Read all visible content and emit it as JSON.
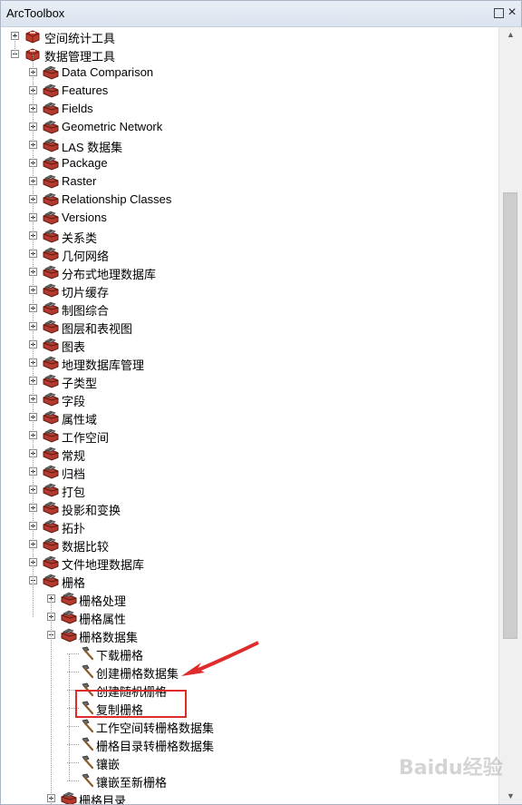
{
  "window": {
    "title": "ArcToolbox"
  },
  "titlebar_buttons": {
    "pin": "□",
    "close": "×"
  },
  "tree": [
    {
      "label": "空间统计工具",
      "level": 0,
      "kind": "toolbox",
      "state": "collapsed"
    },
    {
      "label": "数据管理工具",
      "level": 0,
      "kind": "toolbox",
      "state": "expanded"
    },
    {
      "label": "Data Comparison",
      "level": 1,
      "kind": "toolset",
      "state": "collapsed"
    },
    {
      "label": "Features",
      "level": 1,
      "kind": "toolset",
      "state": "collapsed"
    },
    {
      "label": "Fields",
      "level": 1,
      "kind": "toolset",
      "state": "collapsed"
    },
    {
      "label": "Geometric Network",
      "level": 1,
      "kind": "toolset",
      "state": "collapsed"
    },
    {
      "label": "LAS 数据集",
      "level": 1,
      "kind": "toolset",
      "state": "collapsed"
    },
    {
      "label": "Package",
      "level": 1,
      "kind": "toolset",
      "state": "collapsed"
    },
    {
      "label": "Raster",
      "level": 1,
      "kind": "toolset",
      "state": "collapsed"
    },
    {
      "label": "Relationship Classes",
      "level": 1,
      "kind": "toolset",
      "state": "collapsed"
    },
    {
      "label": "Versions",
      "level": 1,
      "kind": "toolset",
      "state": "collapsed"
    },
    {
      "label": "关系类",
      "level": 1,
      "kind": "toolset",
      "state": "collapsed"
    },
    {
      "label": "几何网络",
      "level": 1,
      "kind": "toolset",
      "state": "collapsed"
    },
    {
      "label": "分布式地理数据库",
      "level": 1,
      "kind": "toolset",
      "state": "collapsed"
    },
    {
      "label": "切片缓存",
      "level": 1,
      "kind": "toolset",
      "state": "collapsed"
    },
    {
      "label": "制图综合",
      "level": 1,
      "kind": "toolset",
      "state": "collapsed"
    },
    {
      "label": "图层和表视图",
      "level": 1,
      "kind": "toolset",
      "state": "collapsed"
    },
    {
      "label": "图表",
      "level": 1,
      "kind": "toolset",
      "state": "collapsed"
    },
    {
      "label": "地理数据库管理",
      "level": 1,
      "kind": "toolset",
      "state": "collapsed"
    },
    {
      "label": "子类型",
      "level": 1,
      "kind": "toolset",
      "state": "collapsed"
    },
    {
      "label": "字段",
      "level": 1,
      "kind": "toolset",
      "state": "collapsed"
    },
    {
      "label": "属性域",
      "level": 1,
      "kind": "toolset",
      "state": "collapsed"
    },
    {
      "label": "工作空间",
      "level": 1,
      "kind": "toolset",
      "state": "collapsed"
    },
    {
      "label": "常规",
      "level": 1,
      "kind": "toolset",
      "state": "collapsed"
    },
    {
      "label": "归档",
      "level": 1,
      "kind": "toolset",
      "state": "collapsed"
    },
    {
      "label": "打包",
      "level": 1,
      "kind": "toolset",
      "state": "collapsed"
    },
    {
      "label": "投影和变换",
      "level": 1,
      "kind": "toolset",
      "state": "collapsed"
    },
    {
      "label": "拓扑",
      "level": 1,
      "kind": "toolset",
      "state": "collapsed"
    },
    {
      "label": "数据比较",
      "level": 1,
      "kind": "toolset",
      "state": "collapsed"
    },
    {
      "label": "文件地理数据库",
      "level": 1,
      "kind": "toolset",
      "state": "collapsed"
    },
    {
      "label": "栅格",
      "level": 1,
      "kind": "toolset",
      "state": "expanded"
    },
    {
      "label": "栅格处理",
      "level": 2,
      "kind": "toolset",
      "state": "collapsed"
    },
    {
      "label": "栅格属性",
      "level": 2,
      "kind": "toolset",
      "state": "collapsed"
    },
    {
      "label": "栅格数据集",
      "level": 2,
      "kind": "toolset",
      "state": "expanded"
    },
    {
      "label": "下载栅格",
      "level": 3,
      "kind": "tool",
      "state": "leaf"
    },
    {
      "label": "创建栅格数据集",
      "level": 3,
      "kind": "tool",
      "state": "leaf"
    },
    {
      "label": "创建随机栅格",
      "level": 3,
      "kind": "tool",
      "state": "leaf"
    },
    {
      "label": "复制栅格",
      "level": 3,
      "kind": "tool",
      "state": "leaf"
    },
    {
      "label": "工作空间转栅格数据集",
      "level": 3,
      "kind": "tool",
      "state": "leaf"
    },
    {
      "label": "栅格目录转栅格数据集",
      "level": 3,
      "kind": "tool",
      "state": "leaf"
    },
    {
      "label": "镶嵌",
      "level": 3,
      "kind": "tool",
      "state": "leaf"
    },
    {
      "label": "镶嵌至新栅格",
      "level": 3,
      "kind": "tool",
      "state": "leaf"
    },
    {
      "label": "栅格目录",
      "level": 2,
      "kind": "toolset",
      "state": "collapsed"
    }
  ],
  "scrollbar": {
    "up": "▲",
    "down": "▼"
  },
  "watermark": "Baidu经验",
  "colors": {
    "annotation": "#e02b2b",
    "toolbox_red": "#c0392b"
  }
}
